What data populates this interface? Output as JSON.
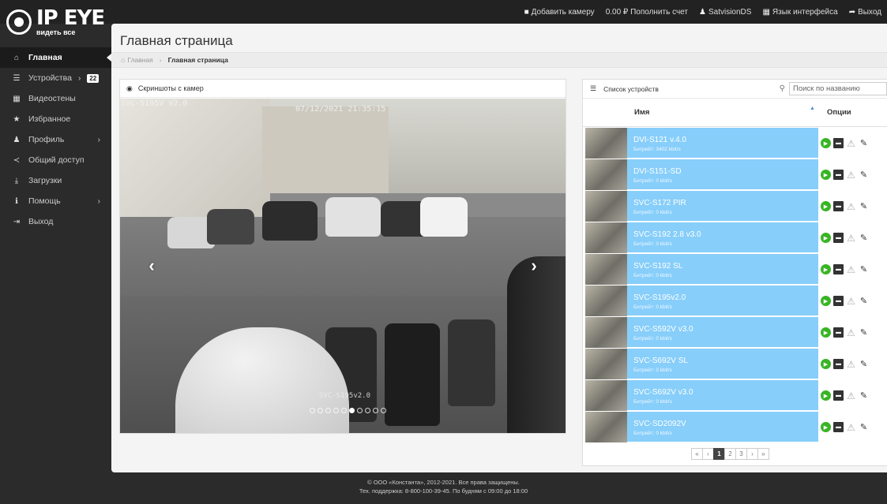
{
  "logo": {
    "main": "IP EYE",
    "sub": "видеть все"
  },
  "topnav": [
    {
      "icon": "camera-icon",
      "glyph": "■",
      "label": "Добавить камеру"
    },
    {
      "icon": "",
      "glyph": "",
      "label": "0.00 ₽ Пополнить счет"
    },
    {
      "icon": "user-icon",
      "glyph": "♟",
      "label": "SatvisionDS"
    },
    {
      "icon": "language-icon",
      "glyph": "▦",
      "label": "Язык интерфейса"
    },
    {
      "icon": "logout-icon",
      "glyph": "➦",
      "label": "Выход"
    }
  ],
  "sidebar": {
    "items": [
      {
        "icon": "home-icon",
        "glyph": "⌂",
        "label": "Главная",
        "active": true
      },
      {
        "icon": "devices-icon",
        "glyph": "☰",
        "label": "Устройства",
        "chevron": "›",
        "badge": "22"
      },
      {
        "icon": "videowall-icon",
        "glyph": "▦",
        "label": "Видеостены"
      },
      {
        "icon": "star-icon",
        "glyph": "★",
        "label": "Избранное"
      },
      {
        "icon": "profile-icon",
        "glyph": "♟",
        "label": "Профиль",
        "chevron": "›",
        "chevronFar": true
      },
      {
        "icon": "share-icon",
        "glyph": "≺",
        "label": "Общий доступ"
      },
      {
        "icon": "download-icon",
        "glyph": "⤓",
        "label": "Загрузки"
      },
      {
        "icon": "info-icon",
        "glyph": "ℹ",
        "label": "Помощь",
        "chevron": "›",
        "chevronFar": true
      },
      {
        "icon": "exit-icon",
        "glyph": "⇥",
        "label": "Выход"
      }
    ]
  },
  "page": {
    "title": "Главная страница",
    "breadcrumb": {
      "home": "Главная",
      "sep": "›",
      "current": "Главная страница"
    }
  },
  "screenshots": {
    "title": "Скриншоты с камер",
    "osd_name": "SVC-S195V V2.0",
    "osd_time": "07/12/2021 21:35:15",
    "caption": "SVC-S195v2.0",
    "prev": "‹",
    "next": "›",
    "dots": 10,
    "active_dot": 5
  },
  "devices": {
    "title": "Список устройств",
    "search_placeholder": "Поиск по названию",
    "col_name": "Имя",
    "col_sort": "▲",
    "col_options": "Опции",
    "rows": [
      {
        "name": "DVI-S121 v.4.0",
        "bitrate": "Битрейт: 3402 kbit/s"
      },
      {
        "name": "DVI-S151-SD",
        "bitrate": "Битрейт: 0 kbit/s"
      },
      {
        "name": "SVC-S172 PIR",
        "bitrate": "Битрейт: 0 kbit/s"
      },
      {
        "name": "SVC-S192 2.8 v3.0",
        "bitrate": "Битрейт: 0 kbit/s"
      },
      {
        "name": "SVC-S192 SL",
        "bitrate": "Битрейт: 0 kbit/s"
      },
      {
        "name": "SVC-S195v2.0",
        "bitrate": "Битрейт: 0 kbit/s"
      },
      {
        "name": "SVC-S592V v3.0",
        "bitrate": "Битрейт: 0 kbit/s"
      },
      {
        "name": "SVC-S692V SL",
        "bitrate": "Битрейт: 0 kbit/s"
      },
      {
        "name": "SVC-S692V v3.0",
        "bitrate": "Битрейт: 0 kbit/s"
      },
      {
        "name": "SVC-SD2092V",
        "bitrate": "Битрейт: 0 kbit/s"
      }
    ],
    "pager": [
      "«",
      "‹",
      "1",
      "2",
      "3",
      "›",
      "»"
    ],
    "active_page": "1"
  },
  "footer": {
    "line1": "© ООО «Константа», 2012-2021. Все права защищены.",
    "line2": "Тех. поддержка: 8-800-100-39-45. По будням с 09:00 до 18:00"
  },
  "colors": {
    "row_bg": "#87cefa",
    "play_green": "#38b524",
    "dark_bg": "#2b2b2b"
  }
}
